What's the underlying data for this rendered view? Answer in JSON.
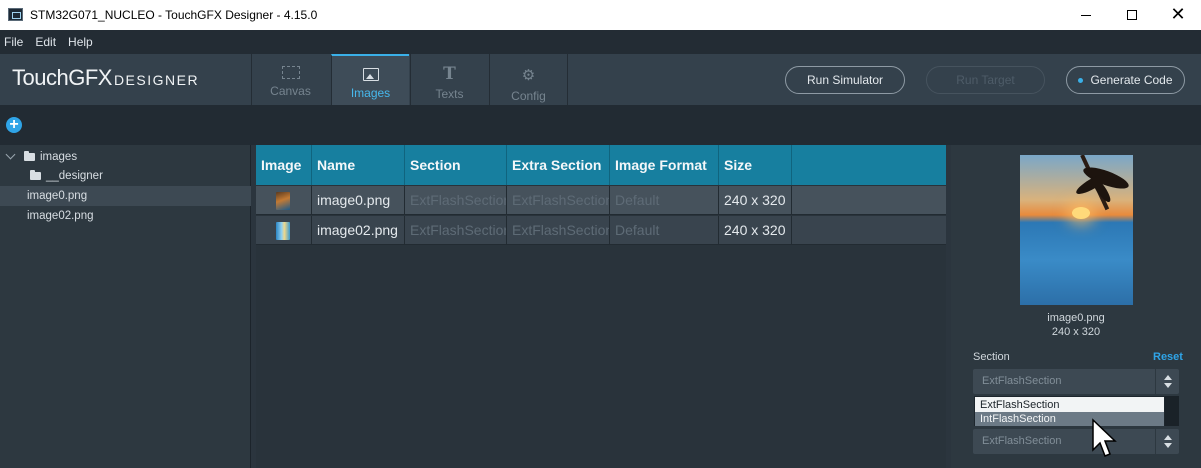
{
  "window": {
    "title": "STM32G071_NUCLEO - TouchGFX Designer - 4.15.0"
  },
  "menu": {
    "items": [
      "File",
      "Edit",
      "Help"
    ]
  },
  "logo": {
    "main": "TouchGFX",
    "sub": "DESIGNER"
  },
  "nav_tabs": [
    {
      "label": "Canvas",
      "icon": "canvas-icon"
    },
    {
      "label": "Images",
      "icon": "image-icon",
      "active": true
    },
    {
      "label": "Texts",
      "icon": "text-icon"
    },
    {
      "label": "Config",
      "icon": "gear-icon"
    }
  ],
  "toolbar": {
    "run_simulator": "Run Simulator",
    "run_target": "Run Target",
    "generate_code": "Generate Code"
  },
  "tree": {
    "items": [
      {
        "label": "images",
        "type": "folder",
        "expanded": true
      },
      {
        "label": "__designer",
        "type": "folder"
      },
      {
        "label": "image0.png",
        "type": "file",
        "selected": true
      },
      {
        "label": "image02.png",
        "type": "file"
      }
    ]
  },
  "table": {
    "headers": [
      "Image",
      "Name",
      "Section",
      "Extra Section",
      "Image Format",
      "Size"
    ],
    "rows": [
      {
        "name": "image0.png",
        "section": "ExtFlashSection",
        "extra_section": "ExtFlashSection",
        "format": "Default",
        "size": "240 x 320"
      },
      {
        "name": "image02.png",
        "section": "ExtFlashSection",
        "extra_section": "ExtFlashSection",
        "format": "Default",
        "size": "240 x 320"
      }
    ]
  },
  "details": {
    "filename": "image0.png",
    "dimensions": "240 x 320",
    "section_label": "Section",
    "reset_label": "Reset",
    "section_value": "ExtFlashSection",
    "dropdown_options": [
      "ExtFlashSection",
      "IntFlashSection"
    ],
    "extra_section_value": "ExtFlashSection"
  },
  "colors": {
    "accent": "#2fa4e7",
    "table_header": "#177f9f",
    "background": "#2b353e"
  }
}
